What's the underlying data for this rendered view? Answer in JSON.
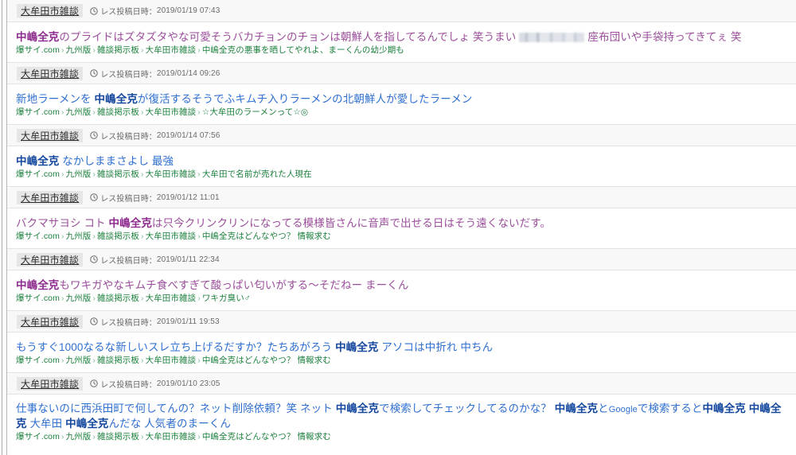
{
  "meta": {
    "posted_label": "レス投稿日時：",
    "clock_icon": "clock-icon",
    "breadcrumb_separator": "›"
  },
  "colors": {
    "visited_link": "#9b4d9b",
    "visited_keyword": "#8e2b8e",
    "unvisited_link": "#2f6fd0",
    "unvisited_keyword": "#14479e",
    "breadcrumb": "#1a7f3c",
    "header_band": "#f8f8f8",
    "badge_background": "#e6e6e6",
    "body_background": "#ffffff"
  },
  "results": [
    {
      "category": "大牟田市雑談",
      "posted_label": "レス投稿日時：",
      "timestamp": "2019/01/19 07:43",
      "state": "visited",
      "title_parts": [
        {
          "text": "中嶋全克",
          "keyword": true
        },
        {
          "text": "のプライドはズタズタやな可愛そうバカチョンのチョンは朝鮮人を指してるんでしょ 笑うまい",
          "keyword": false
        },
        {
          "redacted": true
        },
        {
          "text": "座布団いや手袋持ってきてぇ 笑",
          "keyword": false
        }
      ],
      "breadcrumb": [
        "爆サイ.com",
        "九州版",
        "雑談掲示板",
        "大牟田市雑談",
        "中嶋全克の悪事を晒してやれよ、まーくんの幼少期も"
      ]
    },
    {
      "category": "大牟田市雑談",
      "posted_label": "レス投稿日時：",
      "timestamp": "2019/01/14 09:26",
      "state": "unvisited",
      "title_parts": [
        {
          "text": "新地ラーメンを ",
          "keyword": false
        },
        {
          "text": "中嶋全克",
          "keyword": true
        },
        {
          "text": "が復活するそうでふキムチ入りラーメンの北朝鮮人が愛したラーメン",
          "keyword": false
        }
      ],
      "breadcrumb": [
        "爆サイ.com",
        "九州版",
        "雑談掲示板",
        "大牟田市雑談",
        "☆大牟田のラーメンって☆◎"
      ]
    },
    {
      "category": "大牟田市雑談",
      "posted_label": "レス投稿日時：",
      "timestamp": "2019/01/14 07:56",
      "state": "unvisited",
      "title_parts": [
        {
          "text": "中嶋全克",
          "keyword": true
        },
        {
          "text": " なかしままさよし 最強",
          "keyword": false
        }
      ],
      "breadcrumb": [
        "爆サイ.com",
        "九州版",
        "雑談掲示板",
        "大牟田市雑談",
        "大牟田で名前が売れた人現在"
      ]
    },
    {
      "category": "大牟田市雑談",
      "posted_label": "レス投稿日時：",
      "timestamp": "2019/01/12 11:01",
      "state": "visited",
      "title_parts": [
        {
          "text": "バクマサヨシ コト ",
          "keyword": false
        },
        {
          "text": "中嶋全克",
          "keyword": true
        },
        {
          "text": "は只今クリンクリンになってる模様皆さんに音声で出せる日はそう遠くないだす。",
          "keyword": false
        }
      ],
      "breadcrumb": [
        "爆サイ.com",
        "九州版",
        "雑談掲示板",
        "大牟田市雑談",
        "中嶋全克はどんなやつ？ 情報求む"
      ]
    },
    {
      "category": "大牟田市雑談",
      "posted_label": "レス投稿日時：",
      "timestamp": "2019/01/11 22:34",
      "state": "visited",
      "title_parts": [
        {
          "text": "中嶋全克",
          "keyword": true
        },
        {
          "text": "もワキガやなキムチ食べすぎて酸っぱい匂いがする〜そだねー まーくん",
          "keyword": false
        }
      ],
      "breadcrumb": [
        "爆サイ.com",
        "九州版",
        "雑談掲示板",
        "大牟田市雑談",
        "ワキガ臭い♂"
      ]
    },
    {
      "category": "大牟田市雑談",
      "posted_label": "レス投稿日時：",
      "timestamp": "2019/01/11 19:53",
      "state": "unvisited",
      "title_parts": [
        {
          "text": "もうすぐ1000なるな新しいスレ立ち上げるだすか？たちあがろう ",
          "keyword": false
        },
        {
          "text": "中嶋全克",
          "keyword": true
        },
        {
          "text": " アソコは中折れ 中ちん",
          "keyword": false
        }
      ],
      "breadcrumb": [
        "爆サイ.com",
        "九州版",
        "雑談掲示板",
        "大牟田市雑談",
        "中嶋全克はどんなやつ？ 情報求む"
      ]
    },
    {
      "category": "大牟田市雑談",
      "posted_label": "レス投稿日時：",
      "timestamp": "2019/01/10 23:05",
      "state": "unvisited",
      "wrap": true,
      "title_parts": [
        {
          "text": "仕事ないのに西浜田町で何してんの？ネット削除依頼？笑 ネット ",
          "keyword": false
        },
        {
          "text": "中嶋全克",
          "keyword": true
        },
        {
          "text": "で検索してチェックしてるのかな？ ",
          "keyword": false
        },
        {
          "text": "中嶋全克",
          "keyword": true
        },
        {
          "text": "と",
          "keyword": false
        },
        {
          "text": "Google",
          "keyword": false,
          "small": true
        },
        {
          "text": "で検索すると",
          "keyword": false
        },
        {
          "text": "中嶋全克 中嶋全克",
          "keyword": true
        },
        {
          "text": " 大牟田 ",
          "keyword": false
        },
        {
          "text": "中嶋全克",
          "keyword": true
        },
        {
          "text": "んだな 人気者のまーくん",
          "keyword": false
        }
      ],
      "breadcrumb": [
        "爆サイ.com",
        "九州版",
        "雑談掲示板",
        "大牟田市雑談",
        "中嶋全克はどんなやつ？ 情報求む"
      ]
    }
  ]
}
